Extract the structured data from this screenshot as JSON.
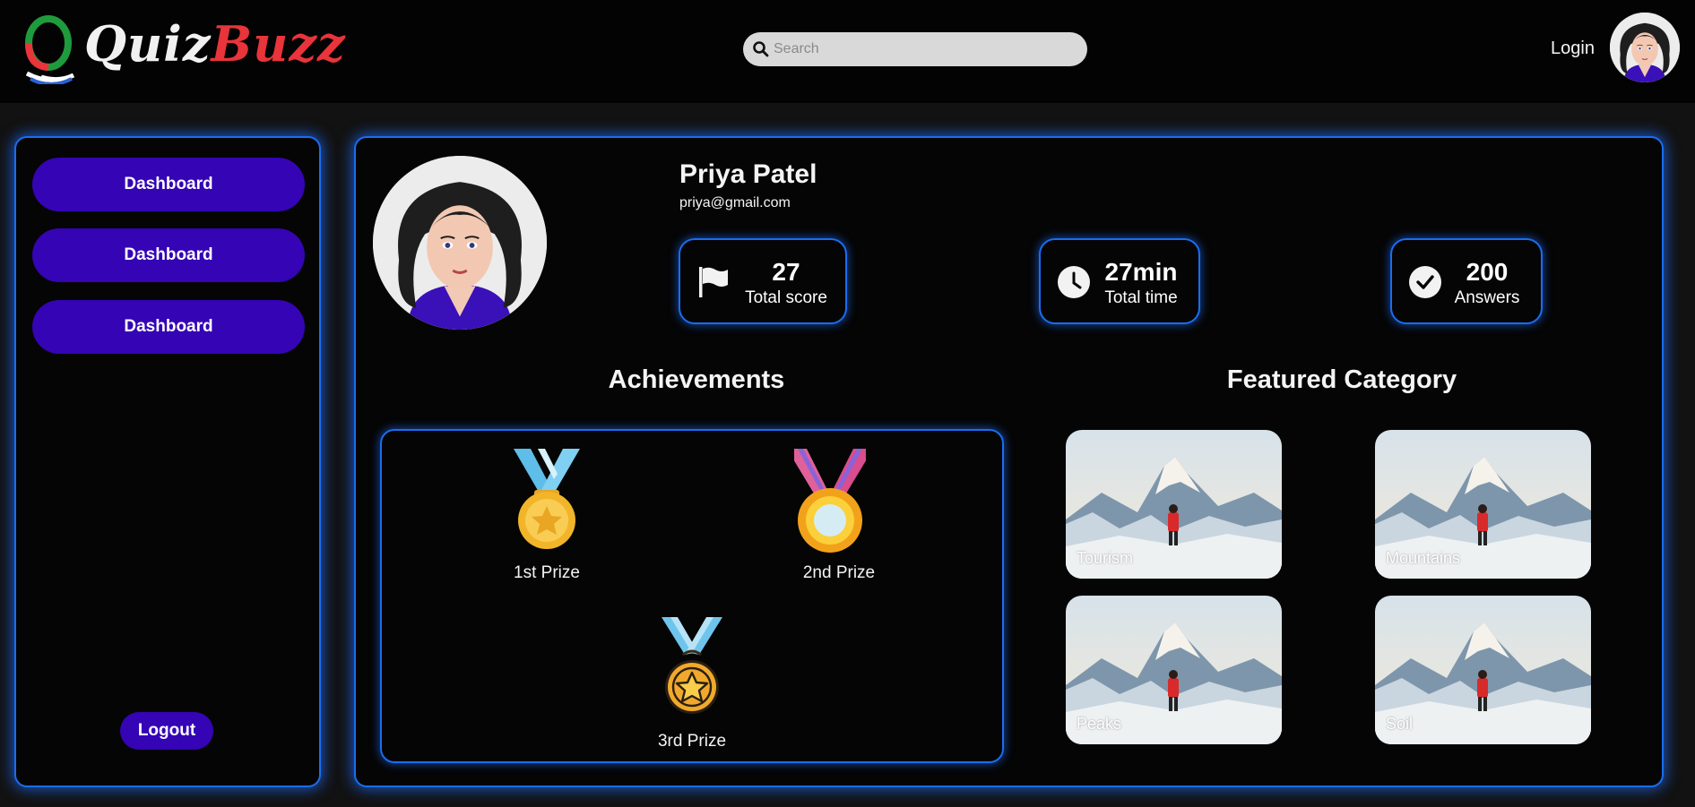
{
  "header": {
    "logo": {
      "part1": "Quiz",
      "part2": "Buzz",
      "icon": "q-logo-icon"
    },
    "search": {
      "placeholder": "Search",
      "value": "",
      "icon": "search-icon"
    },
    "login_label": "Login",
    "avatar_icon": "user-avatar"
  },
  "sidebar": {
    "items": [
      {
        "label": "Dashboard"
      },
      {
        "label": "Dashboard"
      },
      {
        "label": "Dashboard"
      }
    ],
    "logout_label": "Logout"
  },
  "profile": {
    "name": "Priya Patel",
    "email": "priya@gmail.com"
  },
  "stats": [
    {
      "value": "27",
      "label": "Total score",
      "icon": "flag-icon"
    },
    {
      "value": "27min",
      "label": "Total time",
      "icon": "clock-icon"
    },
    {
      "value": "200",
      "label": "Answers",
      "icon": "check-circle-icon"
    }
  ],
  "achievements": {
    "title": "Achievements",
    "items": [
      {
        "label": "1st Prize",
        "icon": "gold-medal-icon"
      },
      {
        "label": "2nd Prize",
        "icon": "silver-medal-icon"
      },
      {
        "label": "3rd Prize",
        "icon": "bronze-medal-icon"
      }
    ]
  },
  "featured": {
    "title": "Featured Category",
    "categories": [
      {
        "label": "Tourism"
      },
      {
        "label": "Mountains"
      },
      {
        "label": "Peaks"
      },
      {
        "label": "Soil"
      }
    ]
  },
  "colors": {
    "accent_blue": "#1a6df0",
    "button_purple": "#3404b5",
    "logo_red": "#e8343a",
    "panel_bg": "#050505",
    "page_bg": "#121212"
  }
}
